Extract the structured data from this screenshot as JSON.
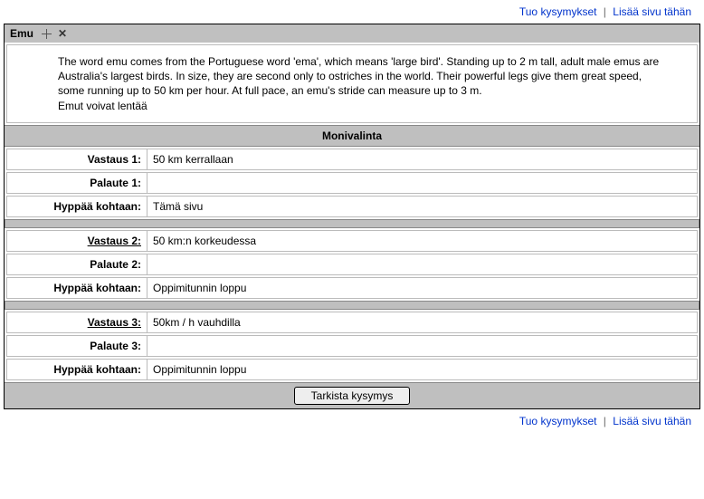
{
  "toplinks": {
    "import_label": "Tuo kysymykset",
    "addpage_label": "Lisää sivu tähän"
  },
  "titlebar": {
    "title": "Emu"
  },
  "content": {
    "paragraph": "The word emu comes from the Portuguese word 'ema', which means 'large bird'. Standing up to 2 m tall, adult male emus are Australia's largest birds. In size, they are second only to ostriches in the world. Their powerful legs give them great speed, some running up to 50 km per hour. At full pace, an emu's stride can measure up to 3 m.",
    "paragraph2": "Emut voivat lentää"
  },
  "section": {
    "heading": "Monivalinta"
  },
  "labels": {
    "answer": "Vastaus",
    "feedback": "Palaute",
    "jump": "Hyppää kohtaan:"
  },
  "answers": [
    {
      "idx": "1",
      "answer_label": "Vastaus 1:",
      "answer_value": "50 km kerrallaan",
      "feedback_label": "Palaute 1:",
      "feedback_value": "",
      "jump_value": "Tämä sivu",
      "underline_answer": false
    },
    {
      "idx": "2",
      "answer_label": "Vastaus 2:",
      "answer_value": "50 km:n korkeudessa",
      "feedback_label": "Palaute 2:",
      "feedback_value": "",
      "jump_value": "Oppimitunnin loppu",
      "underline_answer": true
    },
    {
      "idx": "3",
      "answer_label": "Vastaus 3:",
      "answer_value": "50km / h vauhdilla",
      "feedback_label": "Palaute 3:",
      "feedback_value": "",
      "jump_value": "Oppimitunnin loppu",
      "underline_answer": true
    }
  ],
  "button": {
    "check_label": "Tarkista kysymys"
  }
}
